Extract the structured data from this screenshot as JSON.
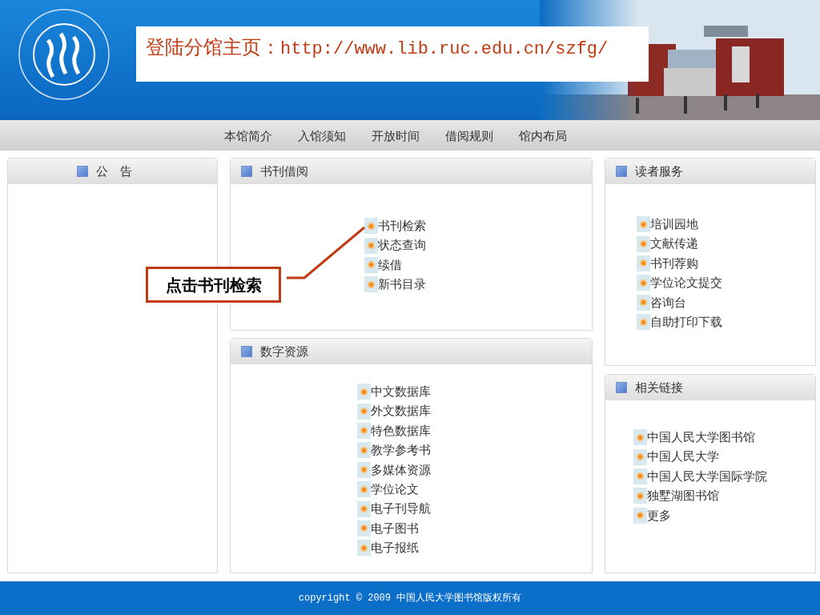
{
  "banner": {
    "label": "登陆分馆主页：",
    "url": "http://www.lib.ruc.edu.cn/szfg/"
  },
  "nav": [
    "本馆简介",
    "入馆须知",
    "开放时间",
    "借阅规则",
    "馆内布局"
  ],
  "panels": [
    {
      "title": "公　告"
    },
    {
      "title": "书刊借阅",
      "items": [
        "书刊检索",
        "状态查询",
        "续借",
        "新书目录"
      ]
    },
    {
      "title": "数字资源",
      "items": [
        "中文数据库",
        "外文数据库",
        "特色数据库",
        "教学参考书",
        "多媒体资源",
        "学位论文",
        "电子刊导航",
        "电子图书",
        "电子报纸"
      ]
    },
    {
      "title": "读者服务",
      "items": [
        "培训园地",
        "文献传递",
        "书刊荐购",
        "学位论文提交",
        "咨询台",
        "自助打印下载"
      ]
    },
    {
      "title": "相关链接",
      "items": [
        "中国人民大学图书馆",
        "中国人民大学",
        "中国人民大学国际学院",
        "独墅湖图书馆",
        "更多"
      ]
    }
  ],
  "callout": {
    "text": "点击书刊检索"
  },
  "footer": "copyright © 2009 中国人民大学图书馆版权所有"
}
